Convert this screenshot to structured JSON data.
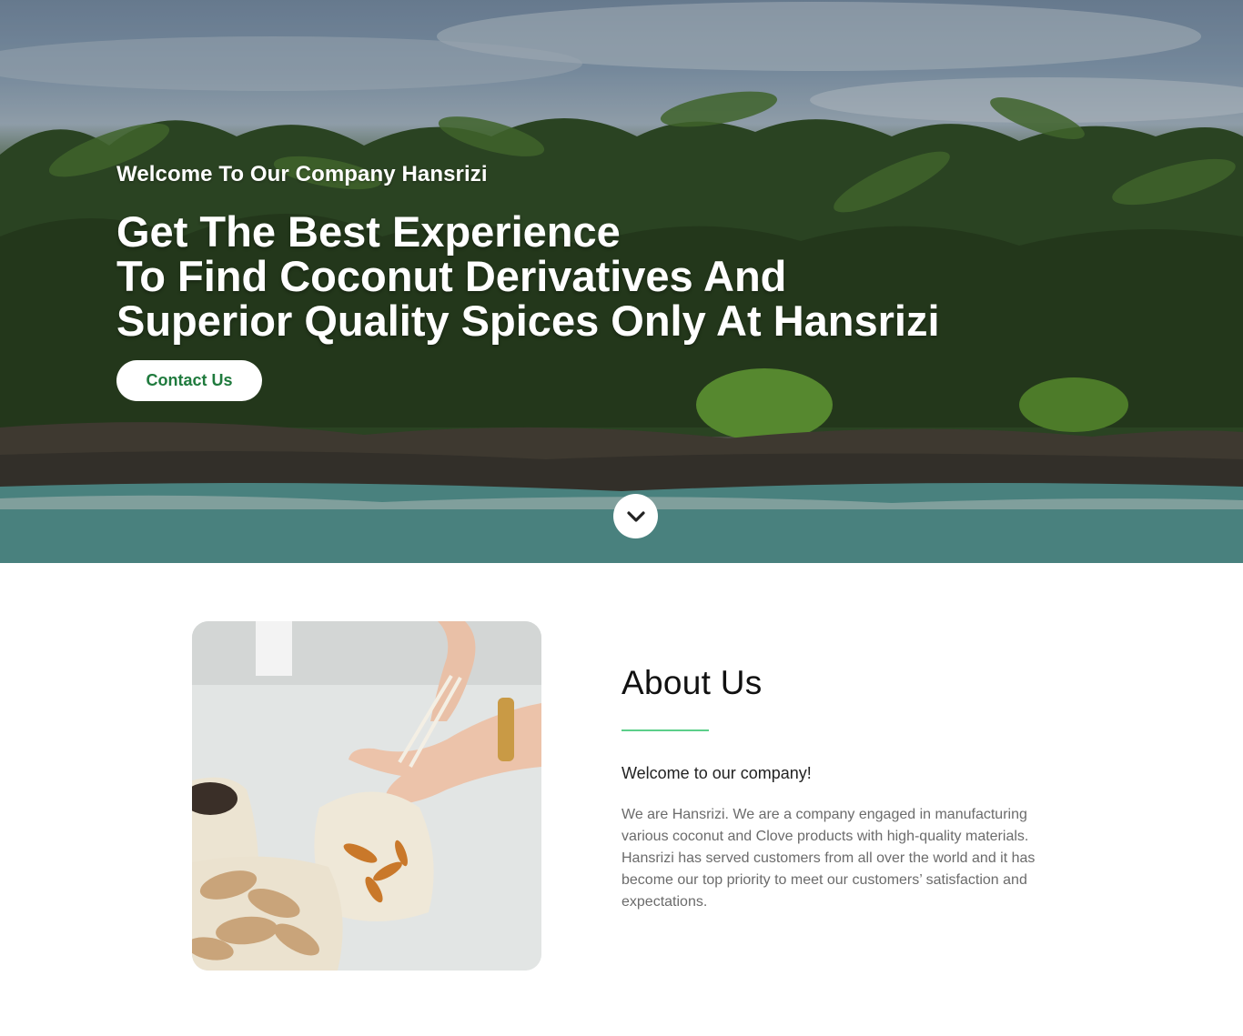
{
  "hero": {
    "subtitle": "Welcome To Our Company Hansrizi",
    "title_lines": [
      "Get The Best Experience",
      "To Find Coconut Derivatives And",
      "Superior Quality Spices Only At Hansrizi"
    ],
    "cta_label": "Contact Us",
    "scroll_icon": "chevron-down-icon",
    "image": "tropical-beach-palm-trees"
  },
  "about": {
    "heading": "About Us",
    "welcome": "Welcome to our company!",
    "body": "We are Hansrizi. We are a company engaged in manufacturing various coconut and Clove products with high-quality materials. Hansrizi has served customers from all over the world and it has become our top priority to meet our customers’ satisfaction and expectations.",
    "image": "ginger-and-turmeric-in-mesh-bags",
    "accent_color": "#5ccf8a"
  },
  "colors": {
    "cta_text": "#1f7a3d",
    "hero_text": "#ffffff"
  }
}
